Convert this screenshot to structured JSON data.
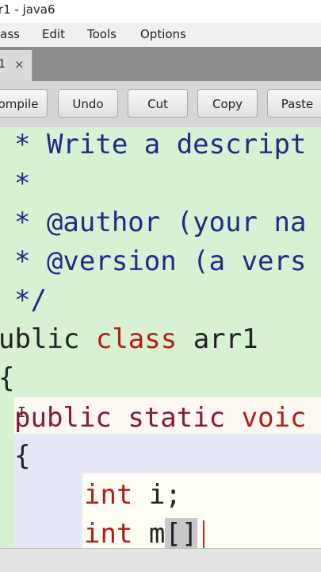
{
  "window": {
    "title": "rr1 - java6"
  },
  "menu": {
    "items": [
      "lass",
      "Edit",
      "Tools",
      "Options"
    ]
  },
  "tab": {
    "label": "1",
    "close": "×"
  },
  "toolbar": {
    "compile": "ompile",
    "undo": "Undo",
    "cut": "Cut",
    "copy": "Copy",
    "paste": "Paste"
  },
  "code": {
    "line1": "* Write a descript",
    "line2": "*",
    "line3": "* @author (your na",
    "line4": "* @version (a vers",
    "line5": "*/",
    "line6_kw1": "ublic",
    "line6_kw2": "class",
    "line6_name": "arr1",
    "line7": "{",
    "line8_kw1": "public",
    "line8_kw2": "static",
    "line8_kw3": "voic",
    "line9": "{",
    "line10_kw": "int",
    "line10_rest": "i;",
    "line11_kw": "int",
    "line11_rest": "m",
    "line11_sel": "[]"
  },
  "colors": {
    "editor_bg": "#d7f1d2",
    "keyword": "#b0201a",
    "comment": "#1f2b88",
    "tab_bar": "#8c8c8c"
  },
  "icons": {
    "text_cursor": "ibeam-cursor-icon"
  }
}
